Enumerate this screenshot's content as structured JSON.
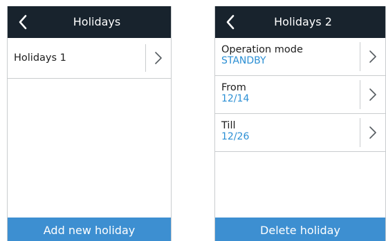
{
  "colors": {
    "header_bg": "#18232d",
    "header_text": "#ffffff",
    "value_text": "#2b8fd4",
    "footer_bg": "#3d8fd1",
    "divider": "#c9ccce"
  },
  "icons": {
    "back": "chevron-left-icon",
    "row_action": "chevron-right-icon"
  },
  "left_screen": {
    "header": {
      "title": "Holidays"
    },
    "items": [
      {
        "label": "Holidays 1"
      }
    ],
    "footer_button": "Add new holiday"
  },
  "right_screen": {
    "header": {
      "title": "Holidays 2"
    },
    "items": [
      {
        "label": "Operation mode",
        "value": "STANDBY"
      },
      {
        "label": "From",
        "value": "12/14"
      },
      {
        "label": "Till",
        "value": "12/26"
      }
    ],
    "footer_button": "Delete holiday"
  }
}
